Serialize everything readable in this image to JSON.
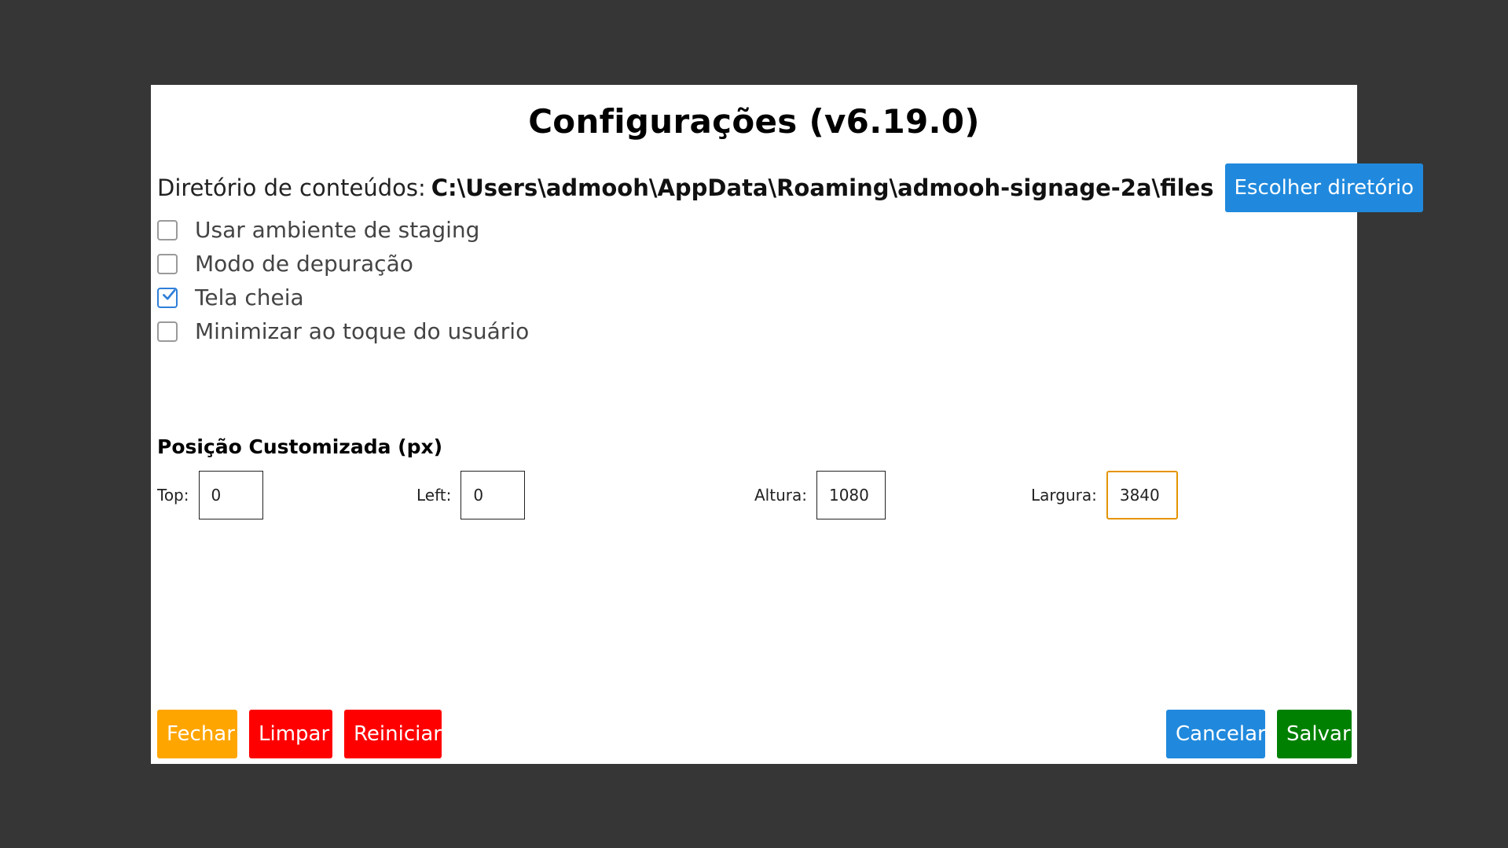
{
  "dialog": {
    "title": "Configurações (v6.19.0)"
  },
  "directory": {
    "label": "Diretório de conteúdos:",
    "path": "C:\\Users\\admooh\\AppData\\Roaming\\admooh-signage-2a\\files",
    "choose_button": "Escolher diretório"
  },
  "options": [
    {
      "label": "Usar ambiente de staging",
      "checked": false
    },
    {
      "label": "Modo de depuração",
      "checked": false
    },
    {
      "label": "Tela cheia",
      "checked": true
    },
    {
      "label": "Minimizar ao toque do usuário",
      "checked": false
    }
  ],
  "position": {
    "title": "Posição Customizada (px)",
    "top": {
      "label": "Top:",
      "value": "0"
    },
    "left": {
      "label": "Left:",
      "value": "0"
    },
    "height": {
      "label": "Altura:",
      "value": "1080"
    },
    "width": {
      "label": "Largura:",
      "value": "3840"
    }
  },
  "buttons": {
    "close": "Fechar",
    "clear": "Limpar",
    "restart": "Reiniciar",
    "cancel": "Cancelar",
    "save": "Salvar"
  },
  "colors": {
    "backdrop": "#363636",
    "blue": "#2089dd",
    "orange": "#ffa500",
    "red": "#ff0000",
    "green": "#008000",
    "focus": "#e59400"
  }
}
